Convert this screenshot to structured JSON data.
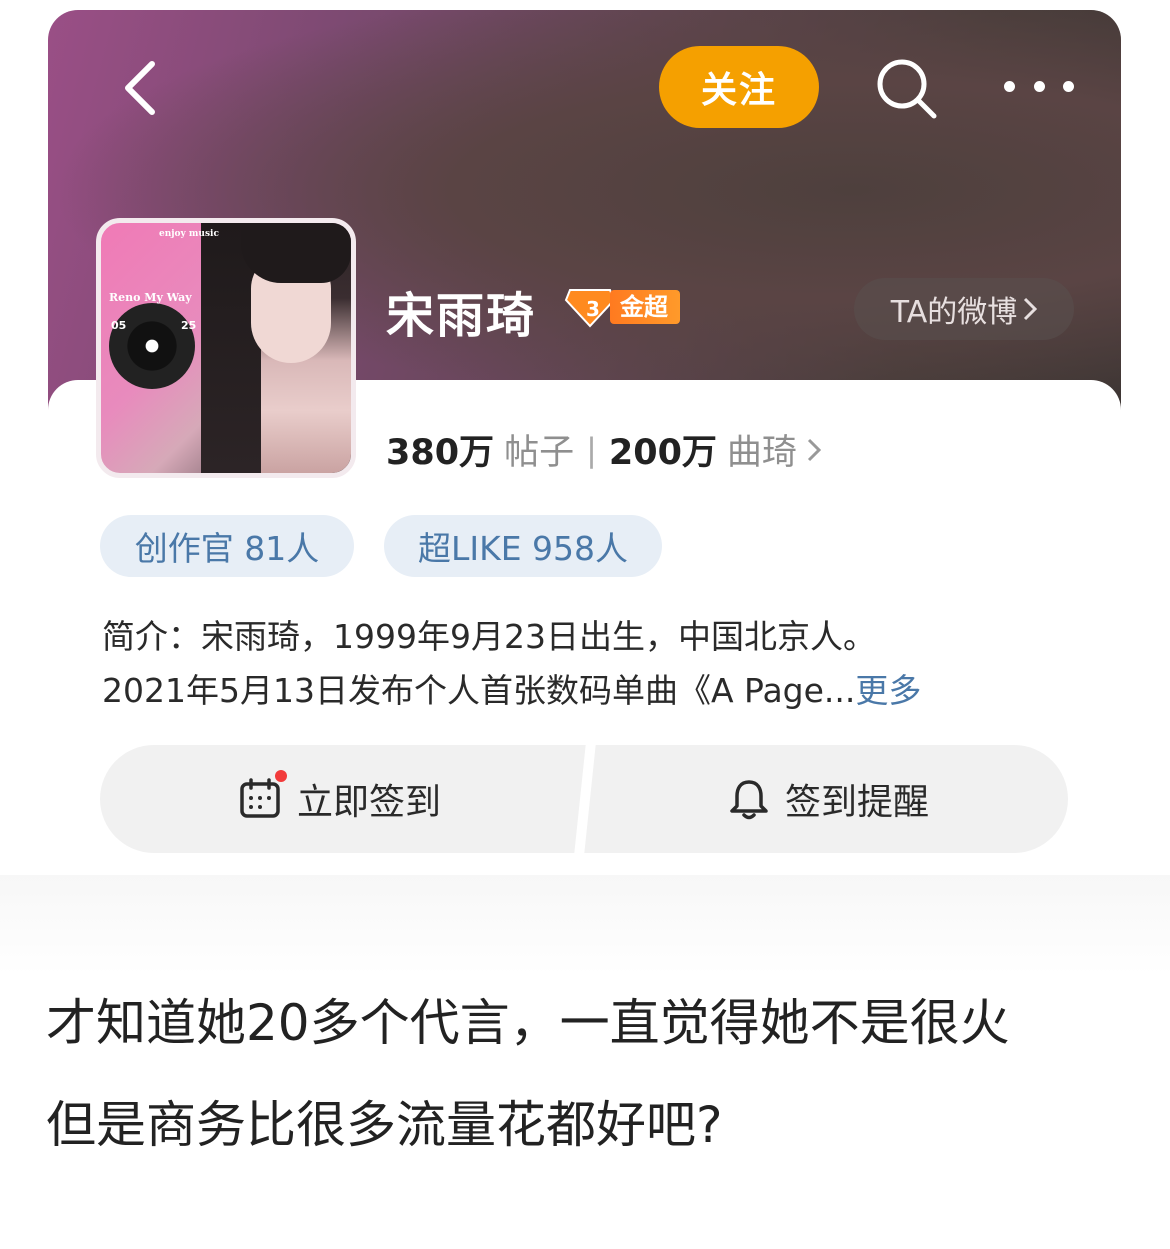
{
  "header": {
    "follow_label": "关注"
  },
  "profile": {
    "name": "宋雨琦",
    "badge_level": "3",
    "badge_label": "金超",
    "ta_weibo_label": "TA的微博",
    "posts_count": "380万",
    "posts_label": "帖子",
    "fans_count": "200万",
    "fans_label": "曲琦",
    "avatar_text_top": "enjoy music",
    "avatar_text_title": "Reno My Way",
    "avatar_num_left": "05",
    "avatar_num_right": "25"
  },
  "pills": [
    {
      "label": "创作官 81人"
    },
    {
      "label": "超LIKE 958人"
    }
  ],
  "bio": {
    "line1": "简介：宋雨琦，1999年9月23日出生，中国北京人。",
    "line2": "2021年5月13日发布个人首张数码单曲《A Page...",
    "more_label": "更多"
  },
  "actions": {
    "checkin_label": "立即签到",
    "reminder_label": "签到提醒"
  },
  "caption": {
    "line1": "才知道她20多个代言，一直觉得她不是很火",
    "line2": "但是商务比很多流量花都好吧?"
  },
  "colors": {
    "follow_button": "#f5a000",
    "link_blue": "#4a78a8",
    "pill_bg": "#e7eef6",
    "badge_orange": "#ff7a20"
  }
}
